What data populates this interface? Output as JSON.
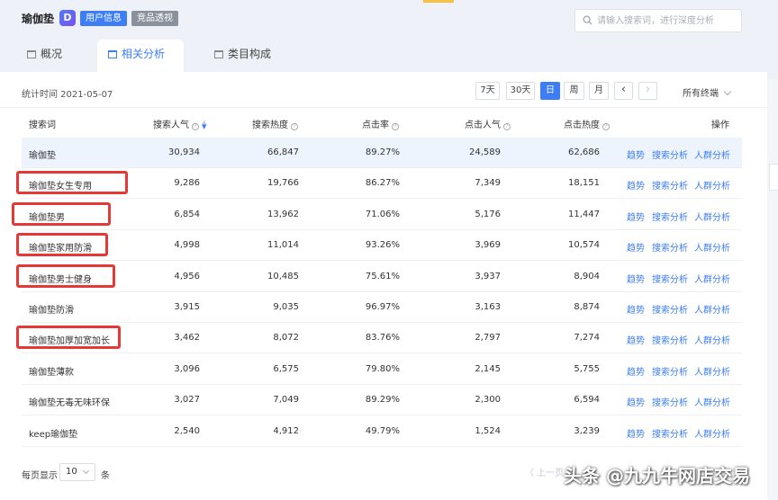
{
  "header": {
    "app_title": "瑜伽垫",
    "logo_letter": "D",
    "pill_user": "用户信息",
    "pill_compete": "竞品透视",
    "search_placeholder": "请输入搜索词，进行深度分析"
  },
  "tabs": [
    {
      "label": "概况",
      "active": false
    },
    {
      "label": "相关分析",
      "active": true
    },
    {
      "label": "类目构成",
      "active": false
    }
  ],
  "toolbar": {
    "stat_label": "统计时间 2021-05-07",
    "ranges": [
      "7天",
      "30天",
      "日",
      "周",
      "月"
    ],
    "active_range": "日",
    "prev_arrow": "‹",
    "next_arrow": "›",
    "terminal": "所有终端"
  },
  "table": {
    "headers": [
      "搜索词",
      "搜索人气",
      "搜索热度",
      "点击率",
      "点击人气",
      "点击热度",
      "操作"
    ],
    "actions": [
      "趋势",
      "搜索分析",
      "人群分析"
    ],
    "rows": [
      {
        "term": "瑜伽垫",
        "search_pop": "30,934",
        "search_heat": "66,847",
        "ctr": "89.27%",
        "click_pop": "24,589",
        "click_heat": "62,686"
      },
      {
        "term": "瑜伽垫女生专用",
        "search_pop": "9,286",
        "search_heat": "19,766",
        "ctr": "86.27%",
        "click_pop": "7,349",
        "click_heat": "18,151"
      },
      {
        "term": "瑜伽垫男",
        "search_pop": "6,854",
        "search_heat": "13,962",
        "ctr": "71.06%",
        "click_pop": "5,176",
        "click_heat": "11,447"
      },
      {
        "term": "瑜伽垫家用防滑",
        "search_pop": "4,998",
        "search_heat": "11,014",
        "ctr": "93.26%",
        "click_pop": "3,969",
        "click_heat": "10,574"
      },
      {
        "term": "瑜伽垫男士健身",
        "search_pop": "4,956",
        "search_heat": "10,485",
        "ctr": "75.61%",
        "click_pop": "3,937",
        "click_heat": "8,904"
      },
      {
        "term": "瑜伽垫防滑",
        "search_pop": "3,915",
        "search_heat": "9,035",
        "ctr": "96.97%",
        "click_pop": "3,163",
        "click_heat": "8,874"
      },
      {
        "term": "瑜伽垫加厚加宽加长",
        "search_pop": "3,462",
        "search_heat": "8,072",
        "ctr": "83.76%",
        "click_pop": "2,797",
        "click_heat": "7,274"
      },
      {
        "term": "瑜伽垫薄款",
        "search_pop": "3,096",
        "search_heat": "6,575",
        "ctr": "79.80%",
        "click_pop": "2,145",
        "click_heat": "5,755"
      },
      {
        "term": "瑜伽垫无毒无味环保",
        "search_pop": "3,027",
        "search_heat": "7,049",
        "ctr": "89.29%",
        "click_pop": "2,300",
        "click_heat": "6,594"
      },
      {
        "term": "keep瑜伽垫",
        "search_pop": "2,540",
        "search_heat": "4,912",
        "ctr": "49.79%",
        "click_pop": "1,524",
        "click_heat": "3,239"
      }
    ]
  },
  "pagination": {
    "per_page_label": "每页显示",
    "per_page_value": "10",
    "unit": "条",
    "prev_label": "〈 上一页"
  },
  "watermark": "头条 @九九牛网店交易",
  "colors": {
    "accent": "#3d7ef5",
    "highlight": "#e53935"
  }
}
